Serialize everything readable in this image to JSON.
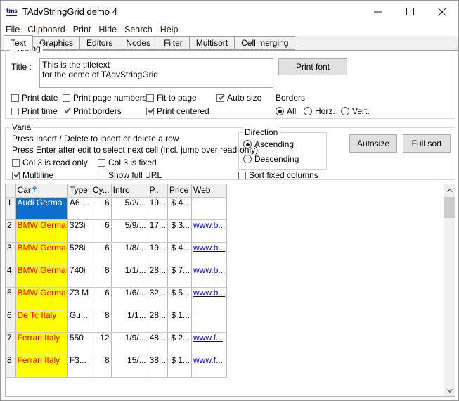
{
  "window": {
    "title": "TAdvStringGrid demo 4",
    "icon": "tms-logo-icon",
    "minimize_label": "minimize-icon",
    "maximize_label": "maximize-icon",
    "close_label": "close-icon"
  },
  "menu": {
    "items": [
      {
        "label": "File"
      },
      {
        "label": "Clipboard"
      },
      {
        "label": "Print"
      },
      {
        "label": "Hide"
      },
      {
        "label": "Search"
      },
      {
        "label": "Help"
      }
    ]
  },
  "tabs": {
    "active": "Text",
    "items": [
      {
        "label": "Text"
      },
      {
        "label": "Graphics"
      },
      {
        "label": "Editors"
      },
      {
        "label": "Nodes"
      },
      {
        "label": "Filter"
      },
      {
        "label": "Multisort"
      },
      {
        "label": "Cell merging"
      }
    ]
  },
  "printing": {
    "legend": "Printing",
    "title_label": "Title :",
    "title_value": "This is the titletext\nfor the demo of TAdvStringGrid",
    "print_font_button": "Print font",
    "checkboxes": [
      {
        "label": "Print date",
        "checked": false
      },
      {
        "label": "Print page numbers",
        "checked": false
      },
      {
        "label": "Fit to page",
        "checked": false
      },
      {
        "label": "Auto size",
        "checked": true
      },
      {
        "label": "Print time",
        "checked": false
      },
      {
        "label": "Print borders",
        "checked": true
      },
      {
        "label": "Print centered",
        "checked": true
      }
    ],
    "borders_label": "Borders",
    "borders_options": [
      {
        "label": "All",
        "checked": true
      },
      {
        "label": "Horz.",
        "checked": false
      },
      {
        "label": "Vert.",
        "checked": false
      }
    ]
  },
  "varia": {
    "legend": "Varia",
    "hint1": "Press Insert / Delete to insert or delete a row",
    "hint2": "Press Enter after edit to select next cell (incl. jump over read-only)",
    "checkboxes": [
      {
        "label": "Col 3 is read only",
        "checked": false
      },
      {
        "label": "Col 3 is fixed",
        "checked": false
      },
      {
        "label": "Multiline",
        "checked": true
      },
      {
        "label": "Show full URL",
        "checked": false
      },
      {
        "label": "Sort fixed columns",
        "checked": false
      }
    ],
    "direction_legend": "Direction",
    "direction_options": [
      {
        "label": "Ascending",
        "checked": true
      },
      {
        "label": "Descending",
        "checked": false
      }
    ],
    "autosize_button": "Autosize",
    "fullsort_button": "Full sort"
  },
  "grid": {
    "sort_column": "Car",
    "sort_indicator": "sort-ascending-arrow-icon",
    "columns": [
      {
        "label": "",
        "key": "rownum",
        "width": 14
      },
      {
        "label": "Car",
        "key": "car",
        "width": 30
      },
      {
        "label": "Type",
        "key": "type",
        "width": 32
      },
      {
        "label": "Cy...",
        "key": "cyl",
        "width": 24
      },
      {
        "label": "Intro",
        "key": "intro",
        "width": 52
      },
      {
        "label": "P...",
        "key": "power",
        "width": 25
      },
      {
        "label": "Price",
        "key": "price",
        "width": 34
      },
      {
        "label": "Web",
        "key": "web",
        "width": 48
      }
    ],
    "rows": [
      {
        "rownum": "1",
        "car": "Audi\nGerma",
        "type": "A6 ...",
        "cyl": "6",
        "intro": "5/2/...",
        "power": "19...",
        "price": "$ 4...",
        "web": "",
        "selected": true
      },
      {
        "rownum": "2",
        "car": "BMW\nGerma",
        "type": "323i",
        "cyl": "6",
        "intro": "5/9/...",
        "power": "17...",
        "price": "$ 3...",
        "web": "www.b...",
        "selected": false
      },
      {
        "rownum": "3",
        "car": "BMW\nGerma",
        "type": "528i",
        "cyl": "6",
        "intro": "1/8/...",
        "power": "19...",
        "price": "$ 4...",
        "web": "www.b...",
        "selected": false
      },
      {
        "rownum": "4",
        "car": "BMW\nGerma",
        "type": "740i",
        "cyl": "8",
        "intro": "1/1/...",
        "power": "28...",
        "price": "$ 7...",
        "web": "www.b...",
        "selected": false
      },
      {
        "rownum": "5",
        "car": "BMW\nGerma",
        "type": "Z3 M",
        "cyl": "6",
        "intro": "1/6/...",
        "power": "32...",
        "price": "$ 5...",
        "web": "www.b...",
        "selected": false
      },
      {
        "rownum": "6",
        "car": "De Tc\nItaly",
        "type": "Gu...",
        "cyl": "8",
        "intro": "1/1...",
        "power": "28...",
        "price": "$ 1...",
        "web": "",
        "selected": false
      },
      {
        "rownum": "7",
        "car": "Ferrari\nItaly",
        "type": "550",
        "cyl": "12",
        "intro": "1/9/...",
        "power": "48...",
        "price": "$ 2...",
        "web": "www.f...",
        "selected": false
      },
      {
        "rownum": "8",
        "car": "Ferrari\nItaly",
        "type": "F3...",
        "cyl": "8",
        "intro": "15/...",
        "power": "38...",
        "price": "$ 1...",
        "web": "www.f...",
        "selected": false
      }
    ],
    "scrollbar": {
      "up_arrow": "scroll-up-icon",
      "down_arrow": "scroll-down-icon"
    }
  },
  "colors": {
    "selection": "#0d6ecd",
    "cell_highlight": "#ffff00",
    "cell_text": "#ff0000",
    "link": "#0000cc"
  }
}
